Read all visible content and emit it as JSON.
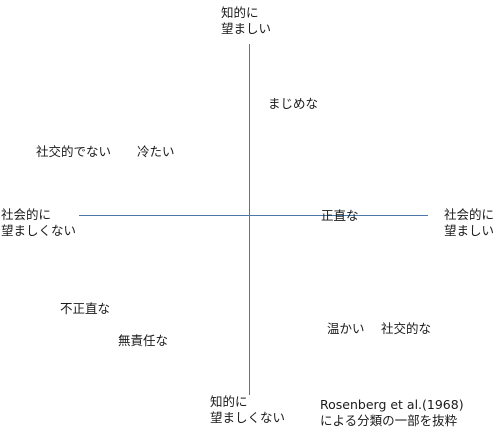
{
  "axes": {
    "top": [
      "知的に",
      "望ましい"
    ],
    "bottom": [
      "知的に",
      "望ましくない"
    ],
    "left": [
      "社会的に",
      "望ましくない"
    ],
    "right": [
      "社会的に",
      "望ましい"
    ]
  },
  "terms": {
    "majime": "まじめな",
    "shakoteki_denai": "社交的でない",
    "tsumetai": "冷たい",
    "shojiki": "正直な",
    "fushojiki": "不正直な",
    "musekinin": "無責任な",
    "atatakai": "温かい",
    "shakoteki": "社交的な"
  },
  "source": [
    "Rosenberg et al.(1968)",
    "による分類の一部を抜粋"
  ]
}
